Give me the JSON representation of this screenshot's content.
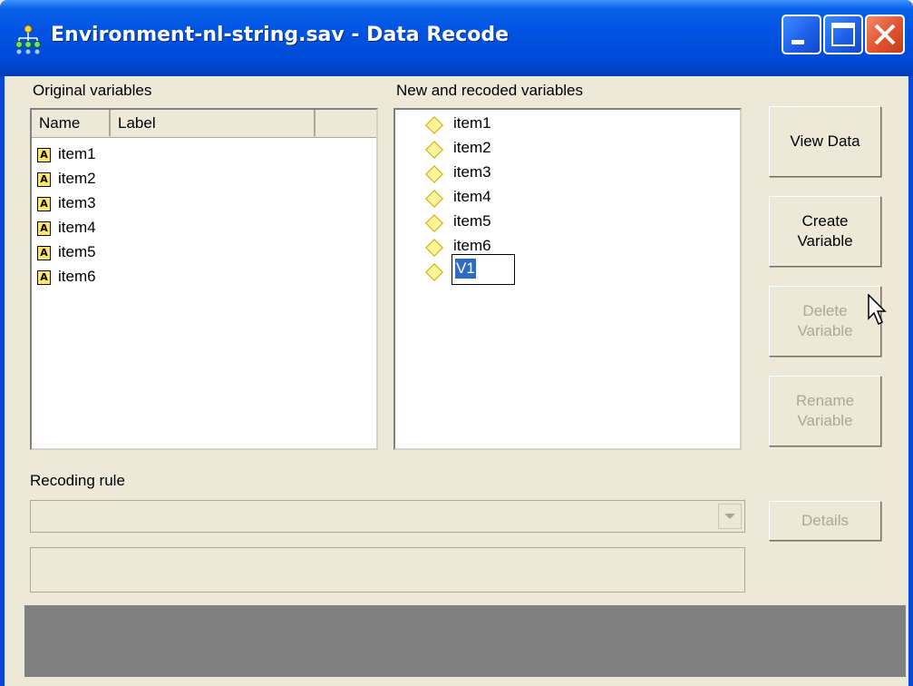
{
  "window": {
    "title": "Environment-nl-string.sav - Data Recode",
    "icon": "network-tree-icon"
  },
  "original_variables": {
    "label": "Original variables",
    "columns": [
      "Name",
      "Label"
    ],
    "items": [
      {
        "name": "item1",
        "label": ""
      },
      {
        "name": "item2",
        "label": ""
      },
      {
        "name": "item3",
        "label": ""
      },
      {
        "name": "item4",
        "label": ""
      },
      {
        "name": "item5",
        "label": ""
      },
      {
        "name": "item6",
        "label": ""
      }
    ],
    "item_icon": "string-variable-icon"
  },
  "new_variables": {
    "label": "New and recoded variables",
    "items": [
      "item1",
      "item2",
      "item3",
      "item4",
      "item5",
      "item6"
    ],
    "editing_value": "V1",
    "item_icon": "diamond-icon"
  },
  "buttons": {
    "view_data": "View Data",
    "create_variable": [
      "Create",
      "Variable"
    ],
    "delete_variable": [
      "Delete",
      "Variable"
    ],
    "rename_variable": [
      "Rename",
      "Variable"
    ],
    "details": "Details"
  },
  "recoding": {
    "label": "Recoding rule",
    "selected": ""
  },
  "colors": {
    "titlebar": "#0054e3",
    "selection": "#316ac5",
    "disabled_text": "#aca899"
  }
}
